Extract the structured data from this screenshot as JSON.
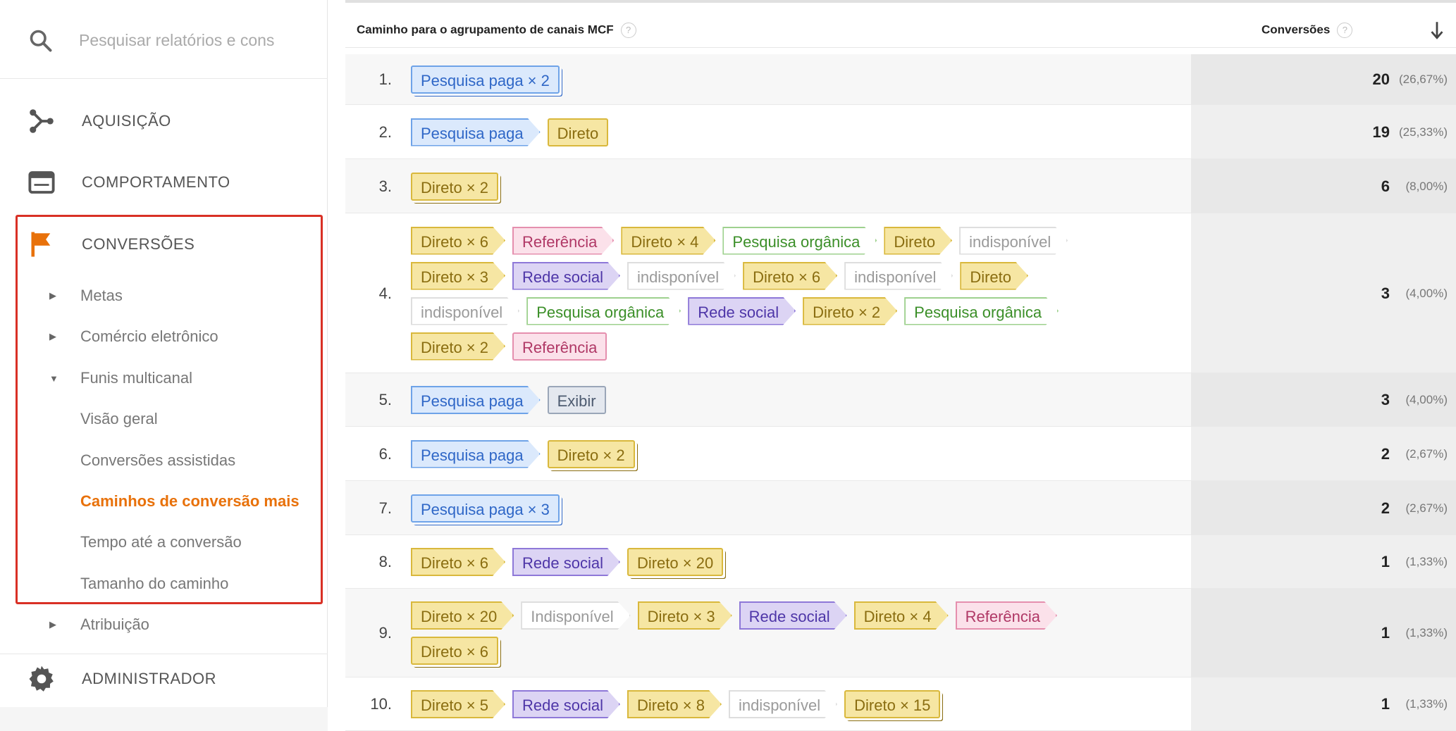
{
  "sidebar": {
    "search_placeholder": "Pesquisar relatórios e cons",
    "acquisition": "AQUISIÇÃO",
    "behavior": "COMPORTAMENTO",
    "conversions": "CONVERSÕES",
    "goals": "Metas",
    "ecommerce": "Comércio eletrônico",
    "multichannel": "Funis multicanal",
    "overview": "Visão geral",
    "assisted": "Conversões assistidas",
    "top_paths": "Caminhos de conversão mais",
    "time_lag": "Tempo até a conversão",
    "path_length": "Tamanho do caminho",
    "attribution": "Atribuição",
    "admin": "ADMINISTRADOR",
    "accent_color": "#e8710a",
    "highlight_color": "#d93025"
  },
  "table": {
    "col_path": "Caminho para o agrupamento de canais MCF",
    "col_conversions": "Conversões",
    "help_glyph": "?",
    "rows": [
      {
        "n": "1.",
        "value": "20",
        "pct": "(26,67%)",
        "lines": [
          [
            {
              "t": "Pesquisa paga × 2",
              "c": "paid",
              "s": true
            }
          ]
        ]
      },
      {
        "n": "2.",
        "value": "19",
        "pct": "(25,33%)",
        "lines": [
          [
            {
              "t": "Pesquisa paga",
              "c": "paid"
            },
            {
              "t": "Direto",
              "c": "direct"
            }
          ]
        ]
      },
      {
        "n": "3.",
        "value": "6",
        "pct": "(8,00%)",
        "lines": [
          [
            {
              "t": "Direto × 2",
              "c": "direct",
              "s": true
            }
          ]
        ]
      },
      {
        "n": "4.",
        "value": "3",
        "pct": "(4,00%)",
        "lines": [
          [
            {
              "t": "Direto × 6",
              "c": "direct",
              "s": true
            },
            {
              "t": "Referência",
              "c": "ref"
            },
            {
              "t": "Direto × 4",
              "c": "direct",
              "s": true
            },
            {
              "t": "Pesquisa orgânica",
              "c": "org"
            },
            {
              "t": "Direto",
              "c": "direct"
            },
            {
              "t": "indisponível",
              "c": "na"
            }
          ],
          [
            {
              "t": "Direto × 3",
              "c": "direct",
              "s": true
            },
            {
              "t": "Rede social",
              "c": "social"
            },
            {
              "t": "indisponível",
              "c": "na"
            },
            {
              "t": "Direto × 6",
              "c": "direct",
              "s": true
            },
            {
              "t": "indisponível",
              "c": "na"
            },
            {
              "t": "Direto",
              "c": "direct"
            }
          ],
          [
            {
              "t": "indisponível",
              "c": "na"
            },
            {
              "t": "Pesquisa orgânica",
              "c": "org"
            },
            {
              "t": "Rede social",
              "c": "social"
            },
            {
              "t": "Direto × 2",
              "c": "direct",
              "s": true
            },
            {
              "t": "Pesquisa orgânica",
              "c": "org"
            }
          ],
          [
            {
              "t": "Direto × 2",
              "c": "direct",
              "s": true
            },
            {
              "t": "Referência",
              "c": "ref"
            }
          ]
        ]
      },
      {
        "n": "5.",
        "value": "3",
        "pct": "(4,00%)",
        "lines": [
          [
            {
              "t": "Pesquisa paga",
              "c": "paid"
            },
            {
              "t": "Exibir",
              "c": "display"
            }
          ]
        ]
      },
      {
        "n": "6.",
        "value": "2",
        "pct": "(2,67%)",
        "lines": [
          [
            {
              "t": "Pesquisa paga",
              "c": "paid"
            },
            {
              "t": "Direto × 2",
              "c": "direct",
              "s": true
            }
          ]
        ]
      },
      {
        "n": "7.",
        "value": "2",
        "pct": "(2,67%)",
        "lines": [
          [
            {
              "t": "Pesquisa paga × 3",
              "c": "paid",
              "s": true
            }
          ]
        ]
      },
      {
        "n": "8.",
        "value": "1",
        "pct": "(1,33%)",
        "lines": [
          [
            {
              "t": "Direto × 6",
              "c": "direct",
              "s": true
            },
            {
              "t": "Rede social",
              "c": "social"
            },
            {
              "t": "Direto × 20",
              "c": "direct",
              "s": true
            }
          ]
        ]
      },
      {
        "n": "9.",
        "value": "1",
        "pct": "(1,33%)",
        "lines": [
          [
            {
              "t": "Direto × 20",
              "c": "direct",
              "s": true
            },
            {
              "t": "Indisponível",
              "c": "na"
            },
            {
              "t": "Direto × 3",
              "c": "direct",
              "s": true
            },
            {
              "t": "Rede social",
              "c": "social"
            },
            {
              "t": "Direto × 4",
              "c": "direct",
              "s": true
            },
            {
              "t": "Referência",
              "c": "ref"
            }
          ],
          [
            {
              "t": "Direto × 6",
              "c": "direct",
              "s": true
            }
          ]
        ]
      },
      {
        "n": "10.",
        "value": "1",
        "pct": "(1,33%)",
        "lines": [
          [
            {
              "t": "Direto × 5",
              "c": "direct",
              "s": true
            },
            {
              "t": "Rede social",
              "c": "social"
            },
            {
              "t": "Direto × 8",
              "c": "direct",
              "s": true
            },
            {
              "t": "indisponível",
              "c": "na"
            },
            {
              "t": "Direto × 15",
              "c": "direct",
              "s": true
            }
          ]
        ]
      }
    ]
  }
}
